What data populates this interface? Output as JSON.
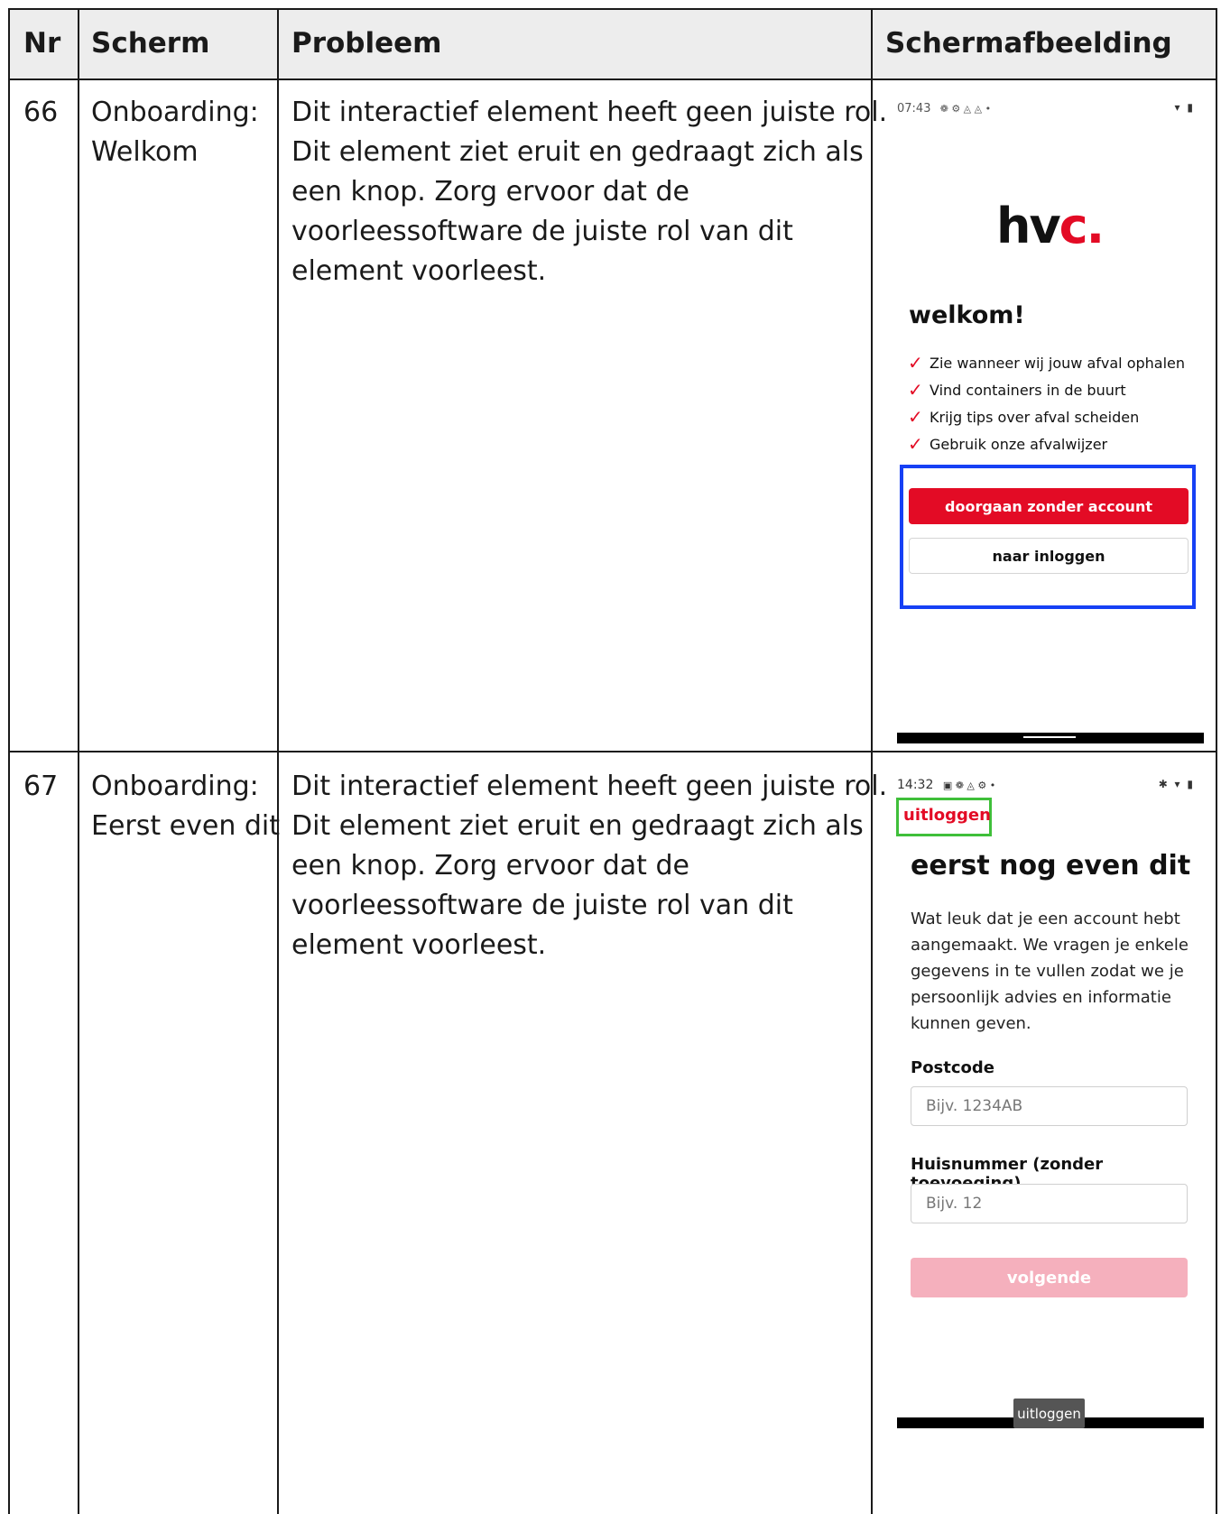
{
  "headers": {
    "nr": "Nr",
    "scherm": "Scherm",
    "probleem": "Probleem",
    "schermafbeelding": "Schermafbeelding"
  },
  "rows": [
    {
      "nr": "66",
      "scherm": "Onboarding: Welkom",
      "probleem": "Dit interactief element heeft geen juiste rol. Dit element ziet eruit en gedraagt zich als een knop. Zorg ervoor dat de voorleessoftware de juiste rol van dit element voorleest.",
      "screenshot": {
        "time": "07:43",
        "status_icons": "❁ ⚙ ◬ ◬ •",
        "status_right": "▾ ▮",
        "logo_text": "hv",
        "logo_accent": "c.",
        "title": "welkom!",
        "features": [
          "Zie wanneer wij jouw afval ophalen",
          "Vind containers in de buurt",
          "Krijg tips over afval scheiden",
          "Gebruik onze afvalwijzer"
        ],
        "primary_button": "doorgaan zonder account",
        "secondary_button": "naar inloggen",
        "highlight_color": "#1640f5",
        "brand_color": "#e30b25"
      }
    },
    {
      "nr": "67",
      "scherm": "Onboarding: Eerst even dit",
      "probleem": "Dit interactief element heeft geen juiste rol. Dit element ziet eruit en gedraagt zich als een knop. Zorg ervoor dat de voorleessoftware de juiste rol van dit element voorleest.",
      "screenshot": {
        "time": "14:32",
        "status_icons": "▣ ❁ ◬ ⚙ •",
        "status_right": "✱ ▾ ▮",
        "logout_link": "uitloggen",
        "title": "eerst nog even dit",
        "intro": "Wat leuk dat je een account hebt aangemaakt. We vragen je enkele gegevens in te vullen zodat we je persoonlijk advies en informatie kunnen geven.",
        "postcode_label": "Postcode",
        "postcode_placeholder": "Bijv. 1234AB",
        "huisnummer_label": "Huisnummer (zonder toevoeging)",
        "huisnummer_placeholder": "Bijv. 12",
        "next_button": "volgende",
        "tooltip": "uitloggen",
        "highlight_color": "#3fbf3a"
      }
    }
  ]
}
